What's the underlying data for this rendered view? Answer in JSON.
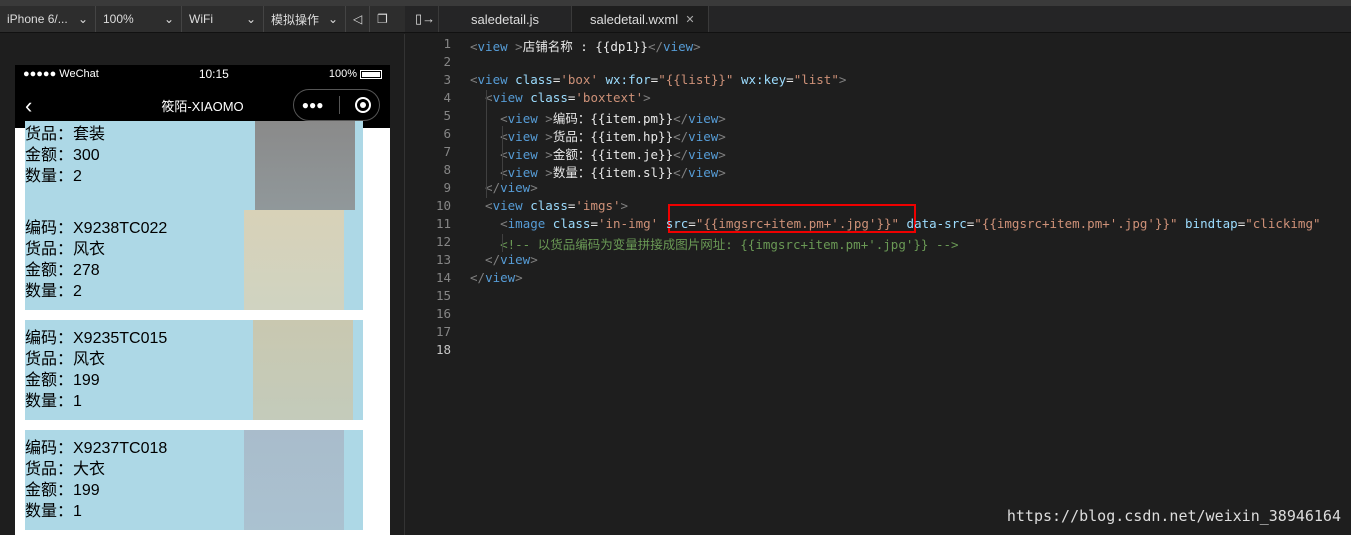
{
  "toolbar": {
    "device": "iPhone 6/...",
    "zoom": "100%",
    "network": "WiFi",
    "simulate": "模拟操作"
  },
  "tabs": [
    {
      "label": "saledetail.js"
    },
    {
      "label": "saledetail.wxml",
      "close": "✕"
    }
  ],
  "phone": {
    "carrier": "●●●●● WeChat",
    "time": "10:15",
    "battery": "100%",
    "title": "筱陌-XIAOMO"
  },
  "cards": [
    {
      "lines": [
        "货品：套装",
        "金额：300",
        "数量：2"
      ],
      "img": "#8a8a8a"
    },
    {
      "lines": [
        "编码：X9238TC022",
        "货品：风衣",
        "金额：278",
        "数量：2"
      ],
      "img": "#d8d2b8"
    },
    {
      "lines": [
        "编码：X9235TC015",
        "货品：风衣",
        "金额：199",
        "数量：1"
      ],
      "img": "#c9c8b0"
    },
    {
      "lines": [
        "编码：X9237TC018",
        "货品：大衣",
        "金额：199",
        "数量：1"
      ],
      "img": "#a9bccb"
    }
  ],
  "code": {
    "lines": [
      [
        [
          "b",
          "<"
        ],
        [
          "tag",
          "view "
        ],
        [
          "b",
          ">"
        ],
        [
          "txt",
          "店铺名称 : {{dp1}}"
        ],
        [
          "b",
          "</"
        ],
        [
          "tag",
          "view"
        ],
        [
          "b",
          ">"
        ]
      ],
      [],
      [
        [
          "b",
          "<"
        ],
        [
          "tag",
          "view "
        ],
        [
          "attr",
          "class"
        ],
        [
          "txt",
          "="
        ],
        [
          "str",
          "'box'"
        ],
        [
          "attr",
          " wx:for"
        ],
        [
          "txt",
          "="
        ],
        [
          "str",
          "\"{{list}}\""
        ],
        [
          "attr",
          " wx:key"
        ],
        [
          "txt",
          "="
        ],
        [
          "str",
          "\"list\""
        ],
        [
          "b",
          ">"
        ]
      ],
      [
        [
          "b",
          "  <"
        ],
        [
          "tag",
          "view "
        ],
        [
          "attr",
          "class"
        ],
        [
          "txt",
          "="
        ],
        [
          "str",
          "'boxtext'"
        ],
        [
          "b",
          ">"
        ]
      ],
      [
        [
          "b",
          "    <"
        ],
        [
          "tag",
          "view "
        ],
        [
          "b",
          ">"
        ],
        [
          "txt",
          "编码：{{item.pm}}"
        ],
        [
          "b",
          "</"
        ],
        [
          "tag",
          "view"
        ],
        [
          "b",
          ">"
        ]
      ],
      [
        [
          "b",
          "    <"
        ],
        [
          "tag",
          "view "
        ],
        [
          "b",
          ">"
        ],
        [
          "txt",
          "货品：{{item.hp}}"
        ],
        [
          "b",
          "</"
        ],
        [
          "tag",
          "view"
        ],
        [
          "b",
          ">"
        ]
      ],
      [
        [
          "b",
          "    <"
        ],
        [
          "tag",
          "view "
        ],
        [
          "b",
          ">"
        ],
        [
          "txt",
          "金额：{{item.je}}"
        ],
        [
          "b",
          "</"
        ],
        [
          "tag",
          "view"
        ],
        [
          "b",
          ">"
        ]
      ],
      [
        [
          "b",
          "    <"
        ],
        [
          "tag",
          "view "
        ],
        [
          "b",
          ">"
        ],
        [
          "txt",
          "数量：{{item.sl}}"
        ],
        [
          "b",
          "</"
        ],
        [
          "tag",
          "view"
        ],
        [
          "b",
          ">"
        ]
      ],
      [
        [
          "b",
          "  </"
        ],
        [
          "tag",
          "view"
        ],
        [
          "b",
          ">"
        ]
      ],
      [
        [
          "b",
          "  <"
        ],
        [
          "tag",
          "view "
        ],
        [
          "attr",
          "class"
        ],
        [
          "txt",
          "="
        ],
        [
          "str",
          "'imgs'"
        ],
        [
          "b",
          ">"
        ]
      ],
      [
        [
          "b",
          "    <"
        ],
        [
          "tag",
          "image "
        ],
        [
          "attr",
          "class"
        ],
        [
          "txt",
          "="
        ],
        [
          "str",
          "'in-img'"
        ],
        [
          "attr",
          " src"
        ],
        [
          "txt",
          "="
        ],
        [
          "str",
          "\"{{imgsrc+item.pm+'.jpg'}}\""
        ],
        [
          "attr",
          " data-src"
        ],
        [
          "txt",
          "="
        ],
        [
          "str",
          "\"{{imgsrc+item.pm+'.jpg'}}\""
        ],
        [
          "attr",
          " bindtap"
        ],
        [
          "txt",
          "="
        ],
        [
          "str",
          "\"clickimg\""
        ]
      ],
      [
        [
          "cm",
          "    <!-- 以货品编码为变量拼接成图片网址: {{imgsrc+item.pm+'.jpg'}} -->"
        ]
      ],
      [
        [
          "b",
          "  </"
        ],
        [
          "tag",
          "view"
        ],
        [
          "b",
          ">"
        ]
      ],
      [
        [
          "b",
          "</"
        ],
        [
          "tag",
          "view"
        ],
        [
          "b",
          ">"
        ]
      ],
      [],
      [],
      [],
      []
    ]
  },
  "watermark": "https://blog.csdn.net/weixin_38946164"
}
